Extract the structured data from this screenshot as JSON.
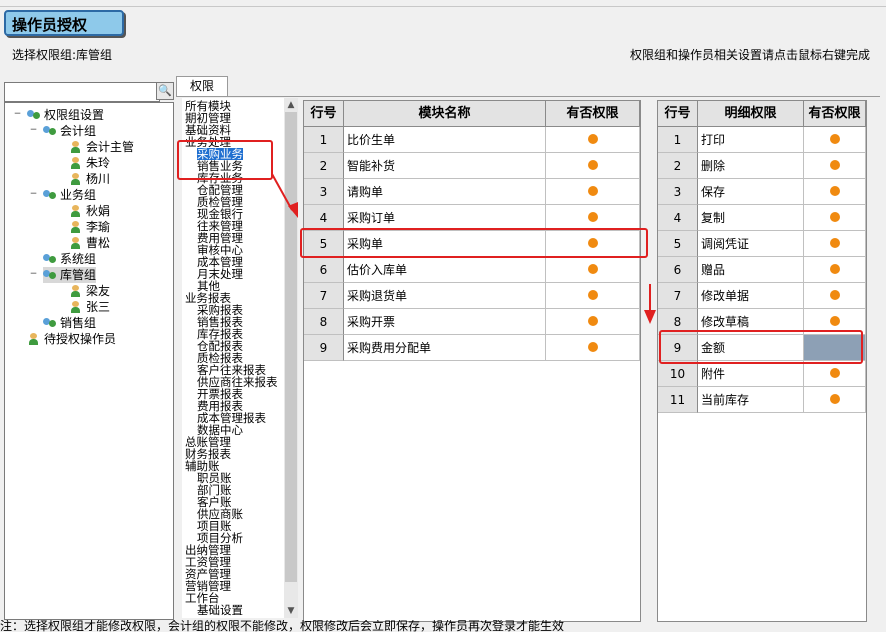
{
  "window": {
    "title_button": "操作员授权",
    "subtitle": "选择权限组:库管组",
    "hint": "权限组和操作员相关设置请点击鼠标右键完成"
  },
  "search": {
    "value": "",
    "placeholder": ""
  },
  "tree": {
    "root": "权限组设置",
    "groups": [
      {
        "label": "会计组",
        "members": [
          "会计主管",
          "朱玲",
          "杨川"
        ]
      },
      {
        "label": "业务组",
        "members": [
          "秋娟",
          "李瑜",
          "曹松"
        ]
      },
      {
        "label": "系统组",
        "members": []
      },
      {
        "label": "库管组",
        "members": [
          "梁友",
          "张三"
        ]
      },
      {
        "label": "销售组",
        "members": []
      }
    ],
    "pending": "待授权操作员"
  },
  "tab": {
    "label": "权限"
  },
  "modules": [
    "所有模块",
    "期初管理",
    "基础资料",
    "业务处理",
    "采购业务",
    "销售业务",
    "库存业务",
    "仓配管理",
    "质检管理",
    "现金银行",
    "往来管理",
    "费用管理",
    "审核中心",
    "成本管理",
    "月末处理",
    "其他",
    "业务报表",
    "采购报表",
    "销售报表",
    "库存报表",
    "仓配报表",
    "质检报表",
    "客户往来报表",
    "供应商往来报表",
    "开票报表",
    "费用报表",
    "成本管理报表",
    "数据中心",
    "总账管理",
    "财务报表",
    "辅助账",
    "职员账",
    "部门账",
    "客户账",
    "供应商账",
    "项目账",
    "项目分析",
    "出纳管理",
    "工资管理",
    "资产管理",
    "营销管理",
    "工作台",
    "基础设置"
  ],
  "module_grid": {
    "headers": [
      "行号",
      "模块名称",
      "有否权限"
    ],
    "rows": [
      {
        "no": "1",
        "name": "比价生单"
      },
      {
        "no": "2",
        "name": "智能补货"
      },
      {
        "no": "3",
        "name": "请购单"
      },
      {
        "no": "4",
        "name": "采购订单"
      },
      {
        "no": "5",
        "name": "采购单"
      },
      {
        "no": "6",
        "name": "估价入库单"
      },
      {
        "no": "7",
        "name": "采购退货单"
      },
      {
        "no": "8",
        "name": "采购开票"
      },
      {
        "no": "9",
        "name": "采购费用分配单"
      }
    ]
  },
  "detail_grid": {
    "headers": [
      "行号",
      "明细权限",
      "有否权限"
    ],
    "rows": [
      {
        "no": "1",
        "name": "打印"
      },
      {
        "no": "2",
        "name": "删除"
      },
      {
        "no": "3",
        "name": "保存"
      },
      {
        "no": "4",
        "name": "复制"
      },
      {
        "no": "5",
        "name": "调阅凭证"
      },
      {
        "no": "6",
        "name": "赠品"
      },
      {
        "no": "7",
        "name": "修改单据"
      },
      {
        "no": "8",
        "name": "修改草稿"
      },
      {
        "no": "9",
        "name": "金额"
      },
      {
        "no": "10",
        "name": "附件"
      },
      {
        "no": "11",
        "name": "当前库存"
      }
    ]
  },
  "status": "注：选择权限组才能修改权限，会计组的权限不能修改，权限修改后会立即保存，操作员再次登录才能生效",
  "colors": {
    "permission_dot": "#f08a10",
    "highlight": "#e02020",
    "no_permission_cell": "#8da0b5"
  }
}
